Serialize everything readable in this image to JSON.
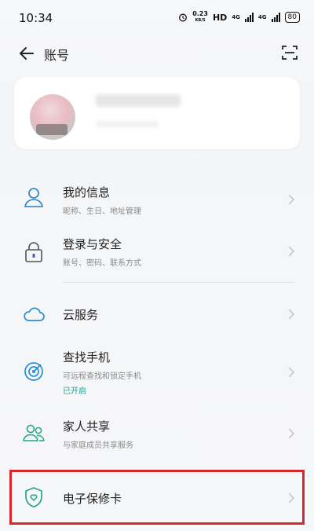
{
  "status": {
    "time": "10:34",
    "speed_value": "0.23",
    "speed_unit": "KB/S",
    "hd_label": "HD",
    "network_1": "4G",
    "network_2": "4G",
    "battery": "80"
  },
  "header": {
    "title": "账号"
  },
  "menu": {
    "items": [
      {
        "title": "我的信息",
        "subtitle": "昵称、生日、地址管理"
      },
      {
        "title": "登录与安全",
        "subtitle": "账号、密码、联系方式"
      },
      {
        "title": "云服务"
      },
      {
        "title": "查找手机",
        "subtitle": "可远程查找和锁定手机",
        "link": "已开启"
      },
      {
        "title": "家人共享",
        "subtitle": "与家庭成员共享服务"
      },
      {
        "title": "电子保修卡"
      }
    ]
  },
  "colors": {
    "accent": "#1aa58e",
    "highlight": "#d9262c"
  }
}
